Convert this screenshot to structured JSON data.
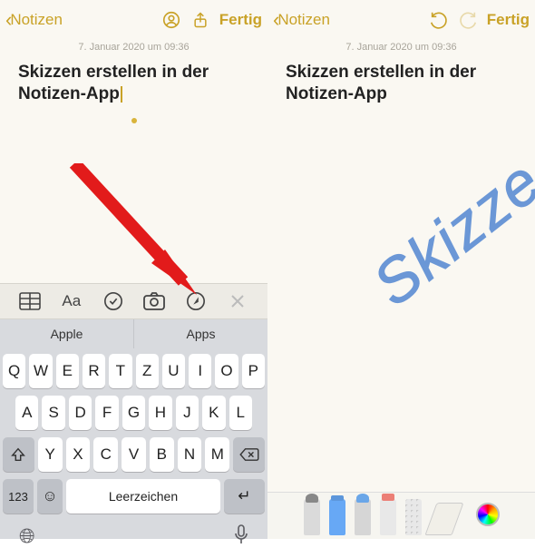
{
  "nav": {
    "back_label": "Notizen",
    "done_label": "Fertig"
  },
  "note": {
    "timestamp": "7. Januar 2020 um 09:36",
    "title": "Skizzen erstellen in der Notizen-App"
  },
  "suggestions": [
    "Apple",
    "Apps"
  ],
  "keyboard": {
    "row1": [
      "Q",
      "W",
      "E",
      "R",
      "T",
      "Z",
      "U",
      "I",
      "O",
      "P"
    ],
    "row2": [
      "A",
      "S",
      "D",
      "F",
      "G",
      "H",
      "J",
      "K",
      "L"
    ],
    "row3": [
      "Y",
      "X",
      "C",
      "V",
      "B",
      "N",
      "M"
    ],
    "numbers_key": "123",
    "space_label": "Leerzeichen"
  },
  "sketch_text": "Skizze"
}
